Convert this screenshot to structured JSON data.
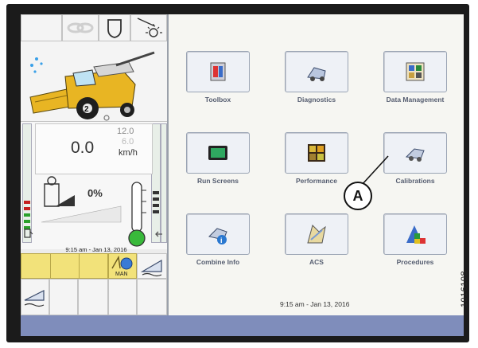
{
  "left_panel": {
    "speed": "0.0",
    "speed_max": "12.0",
    "speed_sub": "6.0",
    "speed_unit": "km/h",
    "percent": "0%",
    "datetime": "9:15 am - Jan 13, 2016",
    "man_label": "MAN"
  },
  "menu": {
    "tiles": [
      {
        "label": "Toolbox",
        "icon": "toolbox-icon"
      },
      {
        "label": "Diagnostics",
        "icon": "diagnostics-icon"
      },
      {
        "label": "Data Management",
        "icon": "data-management-icon"
      },
      {
        "label": "Run Screens",
        "icon": "run-screens-icon"
      },
      {
        "label": "Performance",
        "icon": "performance-icon"
      },
      {
        "label": "Calibrations",
        "icon": "calibrations-icon"
      },
      {
        "label": "Combine Info",
        "icon": "combine-info-icon"
      },
      {
        "label": "ACS",
        "icon": "acs-icon"
      },
      {
        "label": "Procedures",
        "icon": "procedures-icon"
      }
    ],
    "datetime": "9:15 am - Jan 13, 2016"
  },
  "callout": {
    "letter": "A"
  },
  "document_number": "1016108",
  "colors": {
    "screen_bg": "#f6f6f2",
    "bottom_bar": "#7f8dbb",
    "gauge_green": "#39b93b",
    "combine_yellow": "#e8b523"
  }
}
